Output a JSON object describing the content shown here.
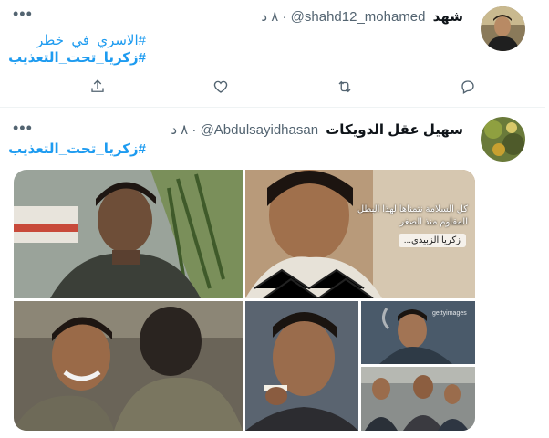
{
  "tweets": [
    {
      "display_name": "شهد",
      "handle": "@shahd12_mohamed",
      "separator": "·",
      "time": "٨ د",
      "more_icon": "more-dots-icon",
      "hashtags": [
        "#الاسري_في_خطر",
        "#زكريا_تحت_التعذيب"
      ],
      "actions": [
        "reply-icon",
        "retweet-icon",
        "like-icon",
        "share-icon"
      ]
    },
    {
      "display_name": "سهيل عقل الدويكات",
      "handle": "@Abdulsayidhasan",
      "separator": "·",
      "time": "٨ د",
      "more_icon": "more-dots-icon",
      "hashtags": [
        "#زكريا_تحت_التعذيب"
      ],
      "photo_caption": {
        "line1": "كل السلامة نتمناها لهذا البطل",
        "line2": "المقاوم منذ الصغر",
        "name": "زكريا الزبيدي..."
      },
      "photo_watermark": "gettyimages"
    }
  ],
  "colors": {
    "link": "#1d9bf0",
    "secondary_text": "#536471",
    "divider": "#eff3f4"
  }
}
